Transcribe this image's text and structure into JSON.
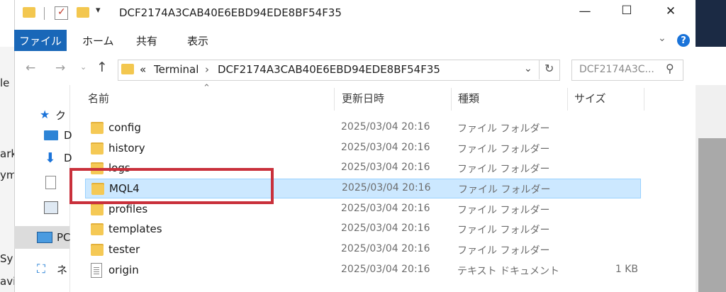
{
  "window": {
    "title": "DCF2174A3CAB40E6EBD94EDE8BF54F35",
    "controls": {
      "minimize": "—",
      "maximize": "☐",
      "close": "✕"
    }
  },
  "ribbon": {
    "tabs": [
      "ファイル",
      "ホーム",
      "共有",
      "表示"
    ],
    "help": "?"
  },
  "address_bar": {
    "overflow": "«",
    "segments": [
      "Terminal",
      "DCF2174A3CAB40E6EBD94EDE8BF54F35"
    ],
    "search_placeholder": "DCF2174A3C..."
  },
  "columns": {
    "name": "名前",
    "modified": "更新日時",
    "type": "種類",
    "size": "サイズ"
  },
  "nav_pane": {
    "items": [
      "ク",
      "D",
      "D",
      "",
      "",
      "PC",
      "ネ"
    ]
  },
  "files": [
    {
      "name": "config",
      "modified": "2025/03/04 20:16",
      "type": "ファイル フォルダー",
      "size": "",
      "kind": "folder"
    },
    {
      "name": "history",
      "modified": "2025/03/04 20:16",
      "type": "ファイル フォルダー",
      "size": "",
      "kind": "folder"
    },
    {
      "name": "logs",
      "modified": "2025/03/04 20:16",
      "type": "ファイル フォルダー",
      "size": "",
      "kind": "folder"
    },
    {
      "name": "MQL4",
      "modified": "2025/03/04 20:16",
      "type": "ファイル フォルダー",
      "size": "",
      "kind": "folder",
      "selected": true
    },
    {
      "name": "profiles",
      "modified": "2025/03/04 20:16",
      "type": "ファイル フォルダー",
      "size": "",
      "kind": "folder"
    },
    {
      "name": "templates",
      "modified": "2025/03/04 20:16",
      "type": "ファイル フォルダー",
      "size": "",
      "kind": "folder"
    },
    {
      "name": "tester",
      "modified": "2025/03/04 20:16",
      "type": "ファイル フォルダー",
      "size": "",
      "kind": "folder"
    },
    {
      "name": "origin",
      "modified": "2025/03/04 20:16",
      "type": "テキスト ドキュメント",
      "size": "1 KB",
      "kind": "text"
    }
  ],
  "background_edge": {
    "left_labels": [
      "le",
      "ark",
      "ym",
      "Sy",
      "avig"
    ]
  },
  "colors": {
    "accent": "#1967b8",
    "selection": "#cce8ff",
    "annotation": "#c9303b",
    "folder": "#f5c955"
  }
}
